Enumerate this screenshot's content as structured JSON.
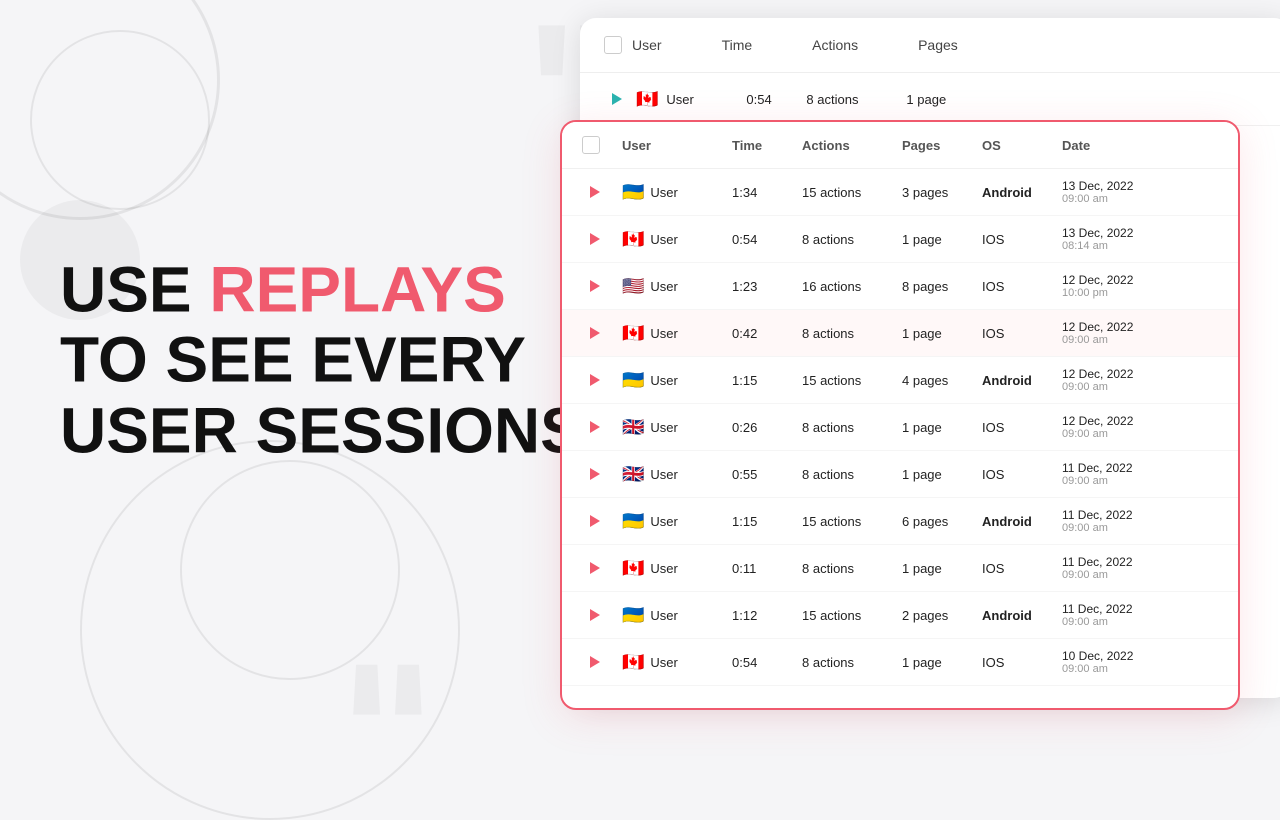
{
  "headline": {
    "line1_plain": "USE ",
    "line1_highlight": "REPLAYS",
    "line2": "TO SEE EVERY",
    "line3": "USER SESSIONS"
  },
  "bg_card": {
    "header": {
      "columns": [
        "User",
        "Time",
        "Actions",
        "Pages"
      ]
    },
    "preview_row": {
      "user": "User",
      "time": "0:54",
      "actions": "8 actions",
      "pages": "1 page"
    }
  },
  "table": {
    "columns": [
      "User",
      "Time",
      "Actions",
      "Pages",
      "OS",
      "Date"
    ],
    "rows": [
      {
        "flag": "🇺🇦",
        "user": "User",
        "time": "1:34",
        "actions": "15 actions",
        "pages": "3 pages",
        "os": "Android",
        "date": "13 Dec, 2022",
        "time2": "09:00 am",
        "highlighted": false
      },
      {
        "flag": "🇨🇦",
        "user": "User",
        "time": "0:54",
        "actions": "8 actions",
        "pages": "1 page",
        "os": "IOS",
        "date": "13 Dec, 2022",
        "time2": "08:14 am",
        "highlighted": false
      },
      {
        "flag": "🇺🇸",
        "user": "User",
        "time": "1:23",
        "actions": "16 actions",
        "pages": "8 pages",
        "os": "IOS",
        "date": "12 Dec, 2022",
        "time2": "10:00 pm",
        "highlighted": false
      },
      {
        "flag": "🇨🇦",
        "user": "User",
        "time": "0:42",
        "actions": "8 actions",
        "pages": "1 page",
        "os": "IOS",
        "date": "12 Dec, 2022",
        "time2": "09:00 am",
        "highlighted": true
      },
      {
        "flag": "🇺🇦",
        "user": "User",
        "time": "1:15",
        "actions": "15 actions",
        "pages": "4 pages",
        "os": "Android",
        "date": "12 Dec, 2022",
        "time2": "09:00 am",
        "highlighted": false
      },
      {
        "flag": "🇬🇧",
        "user": "User",
        "time": "0:26",
        "actions": "8 actions",
        "pages": "1 page",
        "os": "IOS",
        "date": "12 Dec, 2022",
        "time2": "09:00 am",
        "highlighted": false
      },
      {
        "flag": "🇬🇧",
        "user": "User",
        "time": "0:55",
        "actions": "8 actions",
        "pages": "1 page",
        "os": "IOS",
        "date": "11 Dec, 2022",
        "time2": "09:00 am",
        "highlighted": false
      },
      {
        "flag": "🇺🇦",
        "user": "User",
        "time": "1:15",
        "actions": "15 actions",
        "pages": "6 pages",
        "os": "Android",
        "date": "11 Dec, 2022",
        "time2": "09:00 am",
        "highlighted": false
      },
      {
        "flag": "🇨🇦",
        "user": "User",
        "time": "0:11",
        "actions": "8 actions",
        "pages": "1 page",
        "os": "IOS",
        "date": "11 Dec, 2022",
        "time2": "09:00 am",
        "highlighted": false
      },
      {
        "flag": "🇺🇦",
        "user": "User",
        "time": "1:12",
        "actions": "15 actions",
        "pages": "2 pages",
        "os": "Android",
        "date": "11 Dec, 2022",
        "time2": "09:00 am",
        "highlighted": false
      },
      {
        "flag": "🇨🇦",
        "user": "User",
        "time": "0:54",
        "actions": "8 actions",
        "pages": "1 page",
        "os": "IOS",
        "date": "10 Dec, 2022",
        "time2": "09:00 am",
        "highlighted": false
      }
    ]
  }
}
